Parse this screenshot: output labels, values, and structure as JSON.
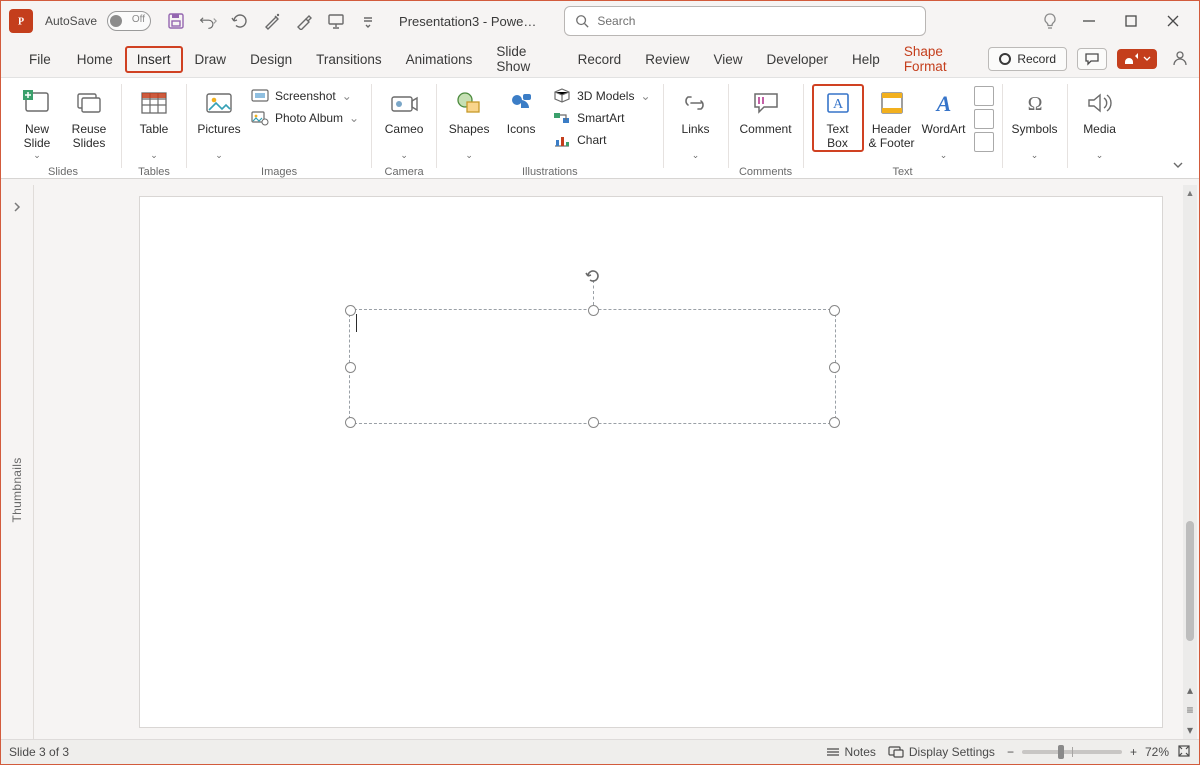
{
  "titlebar": {
    "autosave_label": "AutoSave",
    "autosave_off": "Off",
    "doc_title": "Presentation3  -  Powe…",
    "search_placeholder": "Search"
  },
  "tabs": {
    "items": [
      "File",
      "Home",
      "Insert",
      "Draw",
      "Design",
      "Transitions",
      "Animations",
      "Slide Show",
      "Record",
      "Review",
      "View",
      "Developer",
      "Help"
    ],
    "context": "Shape Format",
    "active_index": 2,
    "record_label": "Record"
  },
  "ribbon": {
    "groups": {
      "slides": {
        "label": "Slides",
        "new_slide": "New\nSlide",
        "reuse": "Reuse\nSlides"
      },
      "tables": {
        "label": "Tables",
        "table": "Table"
      },
      "images": {
        "label": "Images",
        "pictures": "Pictures",
        "screenshot": "Screenshot",
        "photo_album": "Photo Album"
      },
      "camera": {
        "label": "Camera",
        "cameo": "Cameo"
      },
      "illustrations": {
        "label": "Illustrations",
        "shapes": "Shapes",
        "icons": "Icons",
        "models": "3D Models",
        "smartart": "SmartArt",
        "chart": "Chart"
      },
      "links": {
        "label": "",
        "links": "Links"
      },
      "comments": {
        "label": "Comments",
        "comment": "Comment"
      },
      "text": {
        "label": "Text",
        "textbox": "Text\nBox",
        "header": "Header\n& Footer",
        "wordart": "WordArt"
      },
      "symbols": {
        "label": "",
        "symbols": "Symbols"
      },
      "media": {
        "label": "",
        "media": "Media"
      }
    }
  },
  "thumbnails": {
    "label": "Thumbnails"
  },
  "statusbar": {
    "slide": "Slide 3 of 3",
    "notes": "Notes",
    "display": "Display Settings",
    "zoom": "72%"
  }
}
